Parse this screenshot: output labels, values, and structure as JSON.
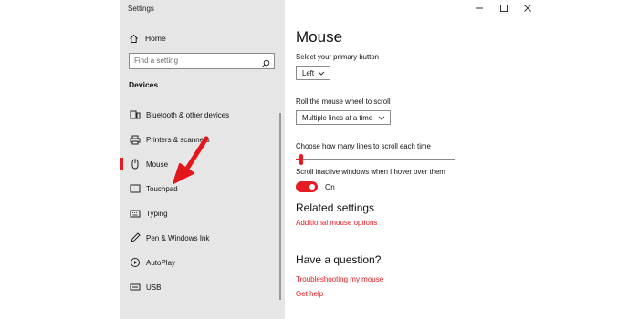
{
  "window": {
    "title": "Settings"
  },
  "sidebar": {
    "home_label": "Home",
    "search_placeholder": "Find a setting",
    "section_heading": "Devices",
    "items": [
      {
        "label": "Bluetooth & other devices",
        "icon": "bluetooth-devices-icon"
      },
      {
        "label": "Printers & scanners",
        "icon": "printer-icon"
      },
      {
        "label": "Mouse",
        "icon": "mouse-icon",
        "active": true
      },
      {
        "label": "Touchpad",
        "icon": "touchpad-icon"
      },
      {
        "label": "Typing",
        "icon": "keyboard-icon"
      },
      {
        "label": "Pen & Windows Ink",
        "icon": "pen-icon"
      },
      {
        "label": "AutoPlay",
        "icon": "autoplay-icon"
      },
      {
        "label": "USB",
        "icon": "usb-icon"
      }
    ]
  },
  "main": {
    "title": "Mouse",
    "primary_button": {
      "label": "Select your primary button",
      "value": "Left"
    },
    "scroll_wheel": {
      "label": "Roll the mouse wheel to scroll",
      "value": "Multiple lines at a time"
    },
    "lines_slider": {
      "label": "Choose how many lines to scroll each time",
      "level": 0.03
    },
    "inactive_scroll": {
      "label": "Scroll inactive windows when I hover over them",
      "state": "On"
    },
    "related": {
      "heading": "Related settings",
      "link": "Additional mouse options"
    },
    "question": {
      "heading": "Have a question?",
      "links": [
        "Troubleshooting my mouse",
        "Get help"
      ]
    }
  },
  "colors": {
    "accent": "#e51c23",
    "sidebar_bg": "#e6e6e6",
    "annotation_arrow": "#e3161b"
  }
}
